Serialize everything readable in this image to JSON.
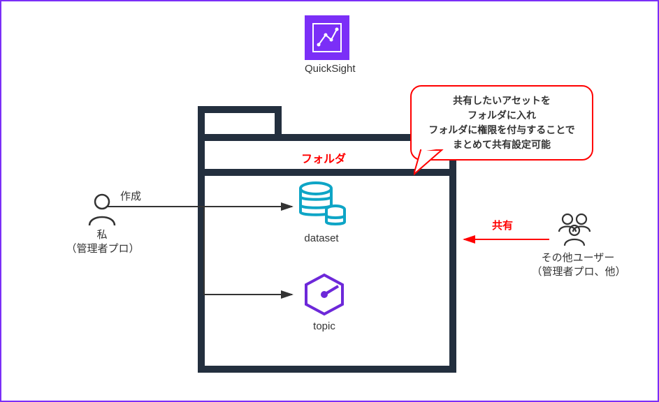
{
  "quicksight": {
    "label": "QuickSight"
  },
  "folder": {
    "label": "フォルダ"
  },
  "callout": {
    "line1": "共有したいアセットを",
    "line2": "フォルダに入れ",
    "line3": "フォルダに権限を付与することで",
    "line4": "まとめて共有設定可能"
  },
  "me": {
    "name": "私",
    "role": "（管理者プロ）",
    "action": "作成"
  },
  "others": {
    "name": "その他ユーザー",
    "role": "（管理者プロ、他）",
    "action": "共有"
  },
  "items": {
    "dataset": "dataset",
    "topic": "topic"
  }
}
